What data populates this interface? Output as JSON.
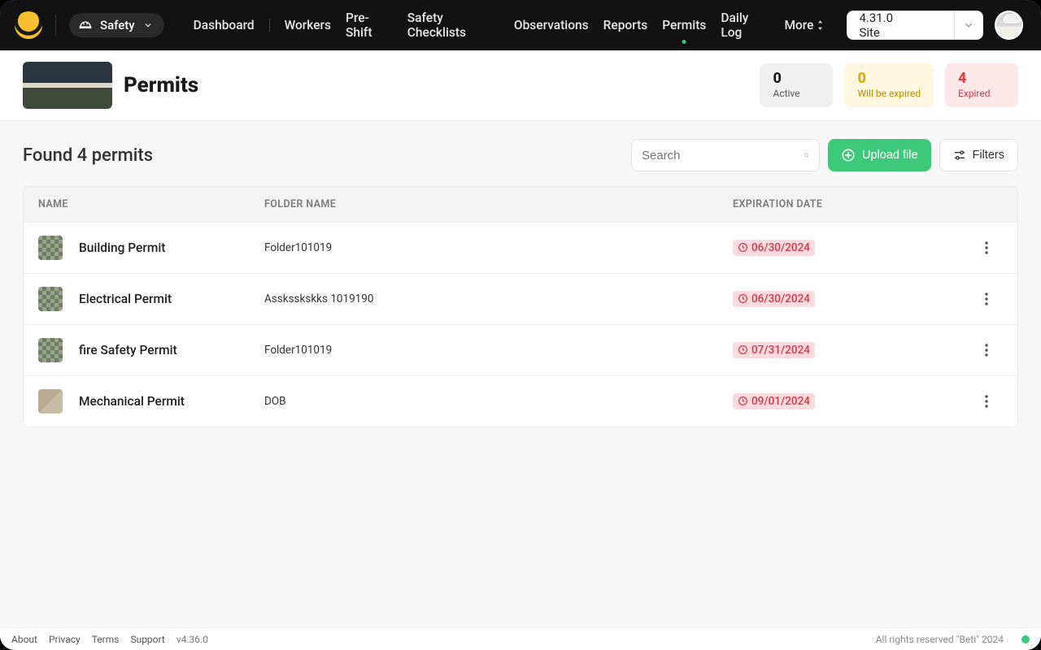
{
  "nav": {
    "safety_label": "Safety",
    "links": {
      "dashboard": "Dashboard",
      "workers": "Workers",
      "preshift": "Pre-Shift",
      "checklists": "Safety Checklists",
      "observations": "Observations",
      "reports": "Reports",
      "permits": "Permits",
      "dailylog": "Daily Log",
      "more": "More"
    },
    "site_select_value": "4.31.0 Site"
  },
  "header": {
    "title": "Permits",
    "stats": {
      "active": {
        "count": "0",
        "label": "Active"
      },
      "will_expire": {
        "count": "0",
        "label": "Will be expired"
      },
      "expired": {
        "count": "4",
        "label": "Expired"
      }
    }
  },
  "list": {
    "found_text": "Found 4 permits",
    "search_placeholder": "Search",
    "upload_label": "Upload file",
    "filters_label": "Filters",
    "columns": {
      "name": "NAME",
      "folder": "FOLDER NAME",
      "expiration": "EXPIRATION DATE"
    },
    "rows": [
      {
        "name": "Building Permit",
        "folder": "Folder101019",
        "expiration": "06/30/2024"
      },
      {
        "name": "Electrical Permit",
        "folder": "Assksskskks 1019190",
        "expiration": "06/30/2024"
      },
      {
        "name": "fire Safety Permit",
        "folder": "Folder101019",
        "expiration": "07/31/2024"
      },
      {
        "name": "Mechanical Permit",
        "folder": "DOB",
        "expiration": "09/01/2024"
      }
    ]
  },
  "footer": {
    "about": "About",
    "privacy": "Privacy",
    "terms": "Terms",
    "support": "Support",
    "version": "v4.36.0",
    "rights": "All rights reserved \"Beti\" 2024"
  }
}
